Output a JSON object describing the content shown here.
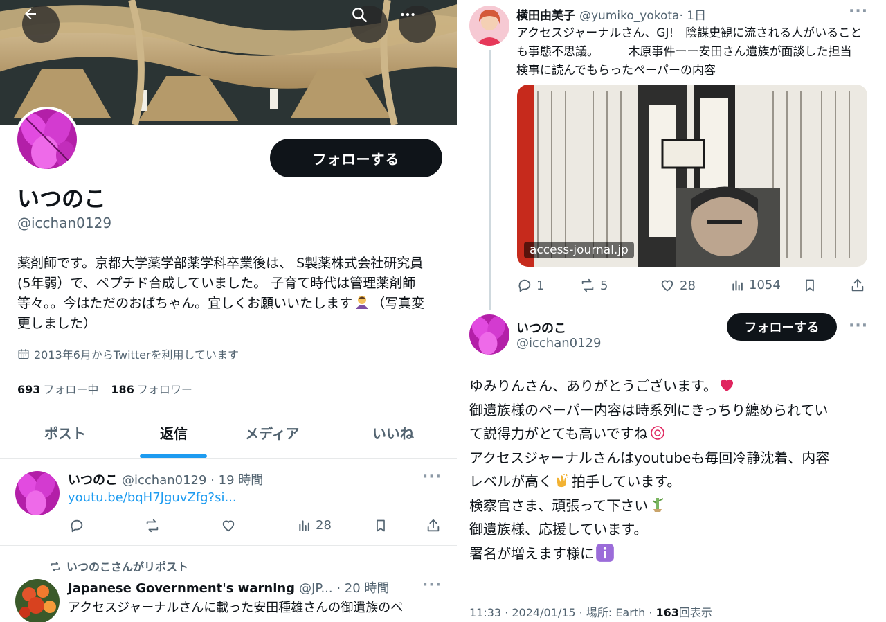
{
  "profile": {
    "name": "いつのこ",
    "handle": "@icchan0129",
    "follow_label": "フォローする",
    "bio_lines": [
      "薬剤師です。京都大学薬学部薬学科卒業後は、 S製薬株式会社研究員",
      "(5年弱）で、ペプチド合成していました。 子育て時代は管理薬剤師",
      "等々。。今はただのおばちゃん。宜しくお願いいたします",
      "（写真変",
      "更しました）"
    ],
    "joined": "2013年6月からTwitterを利用しています",
    "following_count": "693",
    "following_label": "フォロー中",
    "followers_count": "186",
    "followers_label": "フォロワー",
    "icons": {
      "back": "arrow-left-icon",
      "search": "search-icon",
      "more": "more-icon"
    }
  },
  "tabs": [
    {
      "label": "ポスト",
      "active": false
    },
    {
      "label": "返信",
      "active": true
    },
    {
      "label": "メディア",
      "active": false
    },
    {
      "label": "いいね",
      "active": false
    }
  ],
  "feed": [
    {
      "name": "いつのこ",
      "handle": "@icchan0129",
      "time": "· 19 時間",
      "link": "youtu.be/bqH7JguvZfg?si...",
      "views": "28"
    },
    {
      "repost_label": "いつのこさんがリポスト",
      "name": "Japanese Government's warning",
      "handle": "@JP...",
      "time": "· 20 時間",
      "text": "アクセスジャーナルさんに載った安田種雄さんの御遺族のペ"
    }
  ],
  "thread": {
    "quoted": {
      "name": "横田由美子",
      "handle": "@yumiko_yokota",
      "time": "· 1日",
      "text": "アクセスジャーナルさん、GJ!　陰謀史観に流される人がいることも事態不思議。　　　木原事件ーー安田さん遺族が面談した担当検事に読んでもらったペーパーの内容",
      "image_source": "access-journal.jp",
      "replies": "1",
      "reposts": "5",
      "likes": "28",
      "views": "1054"
    },
    "reply": {
      "name": "いつのこ",
      "handle": "@icchan0129",
      "follow_label": "フォローする",
      "lines": [
        "ゆみりんさん、ありがとうございます。",
        "御遺族様のペーパー内容は時系列にきっちり纏められてい",
        "て説得力がとても高いですね",
        "アクセスジャーナルさんはyoutubeも毎回冷静沈着、内容",
        "レベルが高く",
        "拍手しています。",
        "検察官さま、頑張って下さい",
        "御遺族様、応援しています。",
        "署名が増えます様に"
      ],
      "time": "11:33 · 2024/01/15 · 場所: Earth ·",
      "view_count": "163",
      "view_label": "回表示"
    }
  },
  "colors": {
    "accent": "#1d9bf0",
    "text": "#0f1419",
    "muted": "#536471",
    "button": "#0f1419"
  }
}
